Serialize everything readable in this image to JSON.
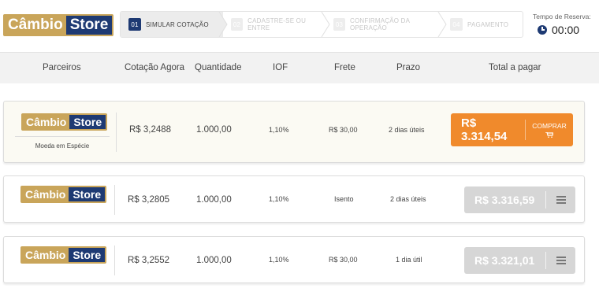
{
  "brand": {
    "part1": "Câmbio",
    "part2": "Store",
    "gold": "#c9a55a",
    "navy": "#1e3a73"
  },
  "steps": [
    {
      "num": "01",
      "label": "Simular Cotação",
      "active": true
    },
    {
      "num": "02",
      "label": "Cadastre-se ou Entre",
      "active": false
    },
    {
      "num": "03",
      "label": "Confirmação da Operação",
      "active": false
    },
    {
      "num": "04",
      "label": "Pagamento",
      "active": false
    }
  ],
  "timer": {
    "label": "Tempo de Reserva:",
    "value": "00:00",
    "icon": "clock-icon"
  },
  "columns": {
    "parceiros": "Parceiros",
    "cotacao": "Cotação Agora",
    "quantidade": "Quantidade",
    "iof": "IOF",
    "frete": "Frete",
    "prazo": "Prazo",
    "total": "Total a pagar"
  },
  "rows": [
    {
      "caption": "Moeda em Espécie",
      "cotacao": "R$ 3,2488",
      "quantidade": "1.000,00",
      "iof": "1,10%",
      "frete": "R$ 30,00",
      "prazo": "2 dias úteis",
      "total": "R$ 3.314,54",
      "action": "COMPRAR",
      "action_icon": "cart-icon",
      "accent": "#f08a2c"
    },
    {
      "cotacao": "R$ 3,2805",
      "quantidade": "1.000,00",
      "iof": "1,10%",
      "frete": "Isento",
      "prazo": "2 dias úteis",
      "total": "R$ 3.316,59",
      "action_icon": "menu-icon"
    },
    {
      "cotacao": "R$ 3,2552",
      "quantidade": "1.000,00",
      "iof": "1,10%",
      "frete": "R$ 30,00",
      "prazo": "1 dia útil",
      "total": "R$ 3.321,01",
      "action_icon": "menu-icon"
    }
  ]
}
